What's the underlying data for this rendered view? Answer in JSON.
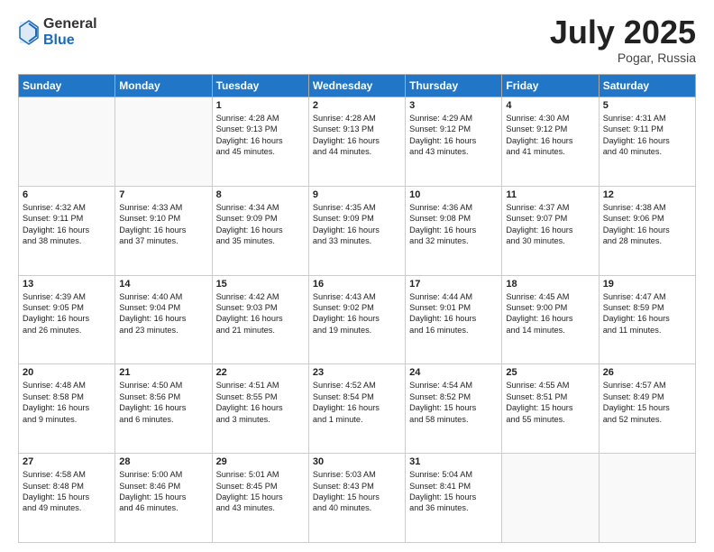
{
  "header": {
    "logo_general": "General",
    "logo_blue": "Blue",
    "month_year": "July 2025",
    "location": "Pogar, Russia"
  },
  "weekdays": [
    "Sunday",
    "Monday",
    "Tuesday",
    "Wednesday",
    "Thursday",
    "Friday",
    "Saturday"
  ],
  "weeks": [
    [
      {
        "day": "",
        "content": ""
      },
      {
        "day": "",
        "content": ""
      },
      {
        "day": "1",
        "content": "Sunrise: 4:28 AM\nSunset: 9:13 PM\nDaylight: 16 hours\nand 45 minutes."
      },
      {
        "day": "2",
        "content": "Sunrise: 4:28 AM\nSunset: 9:13 PM\nDaylight: 16 hours\nand 44 minutes."
      },
      {
        "day": "3",
        "content": "Sunrise: 4:29 AM\nSunset: 9:12 PM\nDaylight: 16 hours\nand 43 minutes."
      },
      {
        "day": "4",
        "content": "Sunrise: 4:30 AM\nSunset: 9:12 PM\nDaylight: 16 hours\nand 41 minutes."
      },
      {
        "day": "5",
        "content": "Sunrise: 4:31 AM\nSunset: 9:11 PM\nDaylight: 16 hours\nand 40 minutes."
      }
    ],
    [
      {
        "day": "6",
        "content": "Sunrise: 4:32 AM\nSunset: 9:11 PM\nDaylight: 16 hours\nand 38 minutes."
      },
      {
        "day": "7",
        "content": "Sunrise: 4:33 AM\nSunset: 9:10 PM\nDaylight: 16 hours\nand 37 minutes."
      },
      {
        "day": "8",
        "content": "Sunrise: 4:34 AM\nSunset: 9:09 PM\nDaylight: 16 hours\nand 35 minutes."
      },
      {
        "day": "9",
        "content": "Sunrise: 4:35 AM\nSunset: 9:09 PM\nDaylight: 16 hours\nand 33 minutes."
      },
      {
        "day": "10",
        "content": "Sunrise: 4:36 AM\nSunset: 9:08 PM\nDaylight: 16 hours\nand 32 minutes."
      },
      {
        "day": "11",
        "content": "Sunrise: 4:37 AM\nSunset: 9:07 PM\nDaylight: 16 hours\nand 30 minutes."
      },
      {
        "day": "12",
        "content": "Sunrise: 4:38 AM\nSunset: 9:06 PM\nDaylight: 16 hours\nand 28 minutes."
      }
    ],
    [
      {
        "day": "13",
        "content": "Sunrise: 4:39 AM\nSunset: 9:05 PM\nDaylight: 16 hours\nand 26 minutes."
      },
      {
        "day": "14",
        "content": "Sunrise: 4:40 AM\nSunset: 9:04 PM\nDaylight: 16 hours\nand 23 minutes."
      },
      {
        "day": "15",
        "content": "Sunrise: 4:42 AM\nSunset: 9:03 PM\nDaylight: 16 hours\nand 21 minutes."
      },
      {
        "day": "16",
        "content": "Sunrise: 4:43 AM\nSunset: 9:02 PM\nDaylight: 16 hours\nand 19 minutes."
      },
      {
        "day": "17",
        "content": "Sunrise: 4:44 AM\nSunset: 9:01 PM\nDaylight: 16 hours\nand 16 minutes."
      },
      {
        "day": "18",
        "content": "Sunrise: 4:45 AM\nSunset: 9:00 PM\nDaylight: 16 hours\nand 14 minutes."
      },
      {
        "day": "19",
        "content": "Sunrise: 4:47 AM\nSunset: 8:59 PM\nDaylight: 16 hours\nand 11 minutes."
      }
    ],
    [
      {
        "day": "20",
        "content": "Sunrise: 4:48 AM\nSunset: 8:58 PM\nDaylight: 16 hours\nand 9 minutes."
      },
      {
        "day": "21",
        "content": "Sunrise: 4:50 AM\nSunset: 8:56 PM\nDaylight: 16 hours\nand 6 minutes."
      },
      {
        "day": "22",
        "content": "Sunrise: 4:51 AM\nSunset: 8:55 PM\nDaylight: 16 hours\nand 3 minutes."
      },
      {
        "day": "23",
        "content": "Sunrise: 4:52 AM\nSunset: 8:54 PM\nDaylight: 16 hours\nand 1 minute."
      },
      {
        "day": "24",
        "content": "Sunrise: 4:54 AM\nSunset: 8:52 PM\nDaylight: 15 hours\nand 58 minutes."
      },
      {
        "day": "25",
        "content": "Sunrise: 4:55 AM\nSunset: 8:51 PM\nDaylight: 15 hours\nand 55 minutes."
      },
      {
        "day": "26",
        "content": "Sunrise: 4:57 AM\nSunset: 8:49 PM\nDaylight: 15 hours\nand 52 minutes."
      }
    ],
    [
      {
        "day": "27",
        "content": "Sunrise: 4:58 AM\nSunset: 8:48 PM\nDaylight: 15 hours\nand 49 minutes."
      },
      {
        "day": "28",
        "content": "Sunrise: 5:00 AM\nSunset: 8:46 PM\nDaylight: 15 hours\nand 46 minutes."
      },
      {
        "day": "29",
        "content": "Sunrise: 5:01 AM\nSunset: 8:45 PM\nDaylight: 15 hours\nand 43 minutes."
      },
      {
        "day": "30",
        "content": "Sunrise: 5:03 AM\nSunset: 8:43 PM\nDaylight: 15 hours\nand 40 minutes."
      },
      {
        "day": "31",
        "content": "Sunrise: 5:04 AM\nSunset: 8:41 PM\nDaylight: 15 hours\nand 36 minutes."
      },
      {
        "day": "",
        "content": ""
      },
      {
        "day": "",
        "content": ""
      }
    ]
  ]
}
